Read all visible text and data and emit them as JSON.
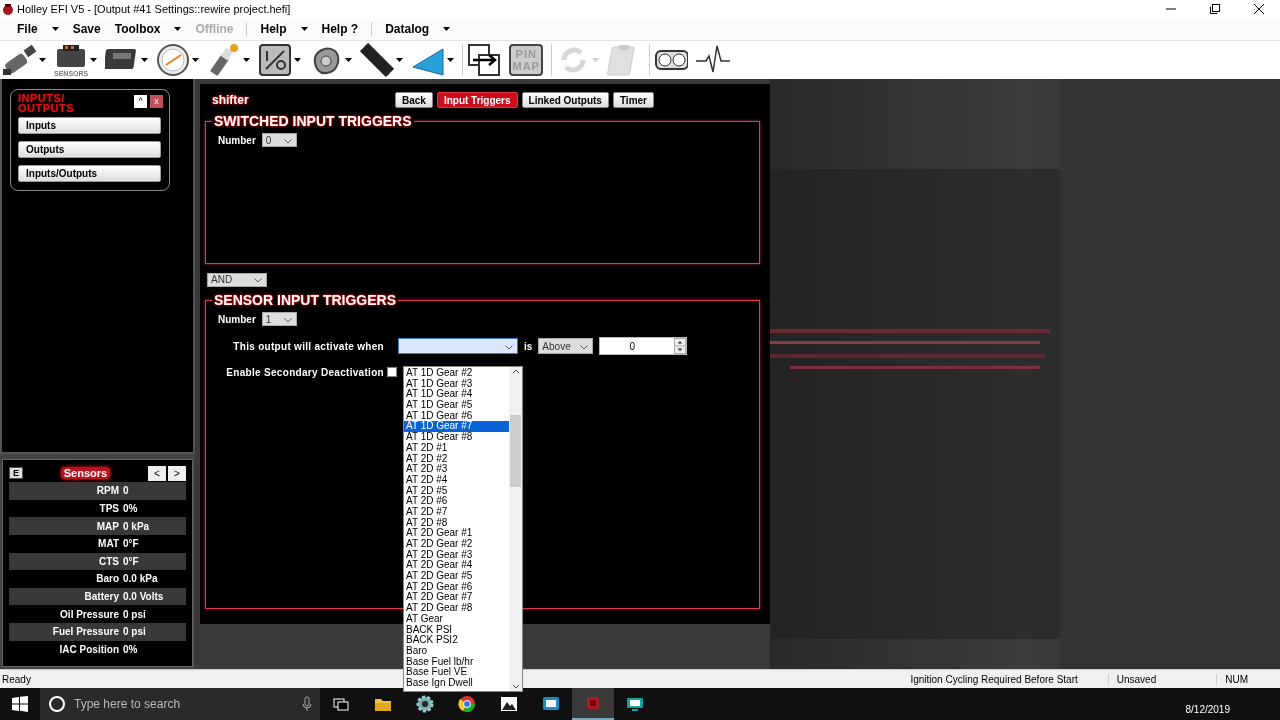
{
  "window": {
    "title": "Holley EFI V5 - [Output #41 Settings::rewire project.hefi]"
  },
  "menu": [
    {
      "label": "File",
      "dropdown": true,
      "disabled": false,
      "separator_before": false
    },
    {
      "label": "Save",
      "dropdown": false,
      "disabled": false,
      "separator_before": false
    },
    {
      "label": "Toolbox",
      "dropdown": true,
      "disabled": false,
      "separator_before": false
    },
    {
      "label": "Offline",
      "dropdown": false,
      "disabled": true,
      "separator_before": false
    },
    {
      "label": "Help",
      "dropdown": true,
      "disabled": false,
      "separator_before": true
    },
    {
      "label": "Help ?",
      "dropdown": false,
      "disabled": false,
      "separator_before": false
    },
    {
      "label": "Datalog",
      "dropdown": true,
      "disabled": false,
      "separator_before": true
    }
  ],
  "toolbar": [
    {
      "kind": "injector",
      "dropdown": true,
      "disabled": false
    },
    {
      "kind": "module",
      "dropdown": true,
      "disabled": false,
      "label": "SENSORS"
    },
    {
      "kind": "ecu",
      "dropdown": true,
      "disabled": false
    },
    {
      "kind": "gauge",
      "dropdown": true,
      "disabled": false
    },
    {
      "kind": "plug",
      "dropdown": true,
      "disabled": false
    },
    {
      "kind": "io",
      "dropdown": true,
      "disabled": false
    },
    {
      "kind": "cam",
      "dropdown": true,
      "disabled": false
    },
    {
      "kind": "stripes",
      "dropdown": true,
      "disabled": false
    },
    {
      "kind": "wedge",
      "dropdown": true,
      "disabled": false
    },
    {
      "kind": "swap",
      "dropdown": false,
      "disabled": false
    },
    {
      "kind": "pinmap",
      "dropdown": false,
      "disabled": false,
      "label": "PIN MAP"
    },
    {
      "kind": "refresh",
      "dropdown": true,
      "disabled": true
    },
    {
      "kind": "clipboard",
      "dropdown": false,
      "disabled": true
    },
    {
      "kind": "gauges",
      "dropdown": false,
      "disabled": false
    },
    {
      "kind": "pulse",
      "dropdown": false,
      "disabled": false
    }
  ],
  "sidebar": {
    "title": "INPUTS/ OUTPUTS",
    "collapse": "^",
    "close": "x",
    "buttons": [
      "Inputs",
      "Outputs",
      "Inputs/Outputs"
    ]
  },
  "sensors": {
    "e_button": "E",
    "title": "Sensors",
    "prev": "<",
    "next": ">",
    "rows": [
      {
        "name": "RPM",
        "value": "0"
      },
      {
        "name": "TPS",
        "value": "0%"
      },
      {
        "name": "MAP",
        "value": "0 kPa"
      },
      {
        "name": "MAT",
        "value": "0°F"
      },
      {
        "name": "CTS",
        "value": "0°F"
      },
      {
        "name": "Baro",
        "value": "0.0 kPa"
      },
      {
        "name": "Battery",
        "value": "0.0 Volts"
      },
      {
        "name": "Oil Pressure",
        "value": "0 psi"
      },
      {
        "name": "Fuel Pressure",
        "value": "0 psi"
      },
      {
        "name": "IAC Position",
        "value": "0%"
      }
    ]
  },
  "page": {
    "name": "shifter",
    "tabs": [
      {
        "label": "Back",
        "selected": false
      },
      {
        "label": "Input Triggers",
        "selected": true
      },
      {
        "label": "Linked Outputs",
        "selected": false
      },
      {
        "label": "Timer",
        "selected": false
      }
    ]
  },
  "switched": {
    "title": "SWITCHED INPUT TRIGGERS",
    "number_label": "Number",
    "number": "0"
  },
  "logic": "AND",
  "sensor": {
    "title": "SENSOR INPUT TRIGGERS",
    "number_label": "Number",
    "number": "1",
    "activate_label": "This output will activate when",
    "channel_expanded": true,
    "is_label": "is",
    "comparison": "Above",
    "threshold": "0",
    "secondary_label": "Enable Secondary Deactivation",
    "secondary_checked": false
  },
  "channel_options": [
    {
      "label": "AT 1D Gear #2",
      "selected": false
    },
    {
      "label": "AT 1D Gear #3",
      "selected": false
    },
    {
      "label": "AT 1D Gear #4",
      "selected": false
    },
    {
      "label": "AT 1D Gear #5",
      "selected": false
    },
    {
      "label": "AT 1D Gear #6",
      "selected": false
    },
    {
      "label": "AT 1D Gear #7",
      "selected": true
    },
    {
      "label": "AT 1D Gear #8",
      "selected": false
    },
    {
      "label": "AT 2D #1",
      "selected": false
    },
    {
      "label": "AT 2D #2",
      "selected": false
    },
    {
      "label": "AT 2D #3",
      "selected": false
    },
    {
      "label": "AT 2D #4",
      "selected": false
    },
    {
      "label": "AT 2D #5",
      "selected": false
    },
    {
      "label": "AT 2D #6",
      "selected": false
    },
    {
      "label": "AT 2D #7",
      "selected": false
    },
    {
      "label": "AT 2D #8",
      "selected": false
    },
    {
      "label": "AT 2D Gear #1",
      "selected": false
    },
    {
      "label": "AT 2D Gear #2",
      "selected": false
    },
    {
      "label": "AT 2D Gear #3",
      "selected": false
    },
    {
      "label": "AT 2D Gear #4",
      "selected": false
    },
    {
      "label": "AT 2D Gear #5",
      "selected": false
    },
    {
      "label": "AT 2D Gear #6",
      "selected": false
    },
    {
      "label": "AT 2D Gear #7",
      "selected": false
    },
    {
      "label": "AT 2D Gear #8",
      "selected": false
    },
    {
      "label": "AT Gear",
      "selected": false
    },
    {
      "label": "BACK PSI",
      "selected": false
    },
    {
      "label": "BACK PSI2",
      "selected": false
    },
    {
      "label": "Baro",
      "selected": false
    },
    {
      "label": "Base Fuel lb/hr",
      "selected": false
    },
    {
      "label": "Base Fuel VE",
      "selected": false
    },
    {
      "label": "Base Ign Dwell",
      "selected": false
    }
  ],
  "status_bar": [
    "Ready",
    "Ignition Cycling Required Before Start",
    "Unsaved",
    "NUM"
  ],
  "taskbar": {
    "search_placeholder": "Type here to search",
    "date": "8/12/2019",
    "apps": [
      {
        "kind": "taskview",
        "active": false
      },
      {
        "kind": "folder",
        "active": false
      },
      {
        "kind": "gear",
        "active": false
      },
      {
        "kind": "browser",
        "active": false
      },
      {
        "kind": "photos",
        "active": false
      },
      {
        "kind": "screen",
        "active": false
      },
      {
        "kind": "holley",
        "active": true
      },
      {
        "kind": "monitor",
        "active": false
      }
    ]
  }
}
